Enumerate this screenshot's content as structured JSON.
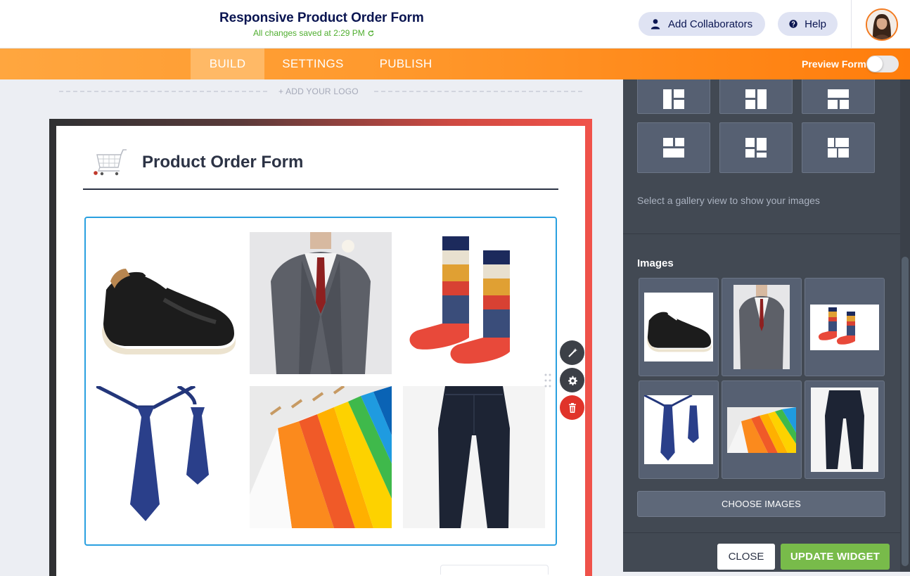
{
  "header": {
    "form_title": "Responsive Product Order Form",
    "save_status": "All changes saved at 2:29 PM",
    "add_collaborators": "Add Collaborators",
    "help": "Help"
  },
  "nav": {
    "tabs": [
      {
        "label": "BUILD",
        "active": true
      },
      {
        "label": "SETTINGS",
        "active": false
      },
      {
        "label": "PUBLISH",
        "active": false
      }
    ],
    "preview_label": "Preview Form",
    "preview_enabled": false
  },
  "canvas": {
    "logo_placeholder": "+ ADD YOUR LOGO",
    "form_heading": "Product Order Form",
    "gallery_images": [
      "sneaker",
      "gray-suit",
      "patterned-socks",
      "blue-ties",
      "colorful-shirts",
      "dark-jeans"
    ]
  },
  "panel": {
    "gallery_hint": "Select a gallery view to show your images",
    "images_label": "Images",
    "choose_images": "CHOOSE IMAGES",
    "close": "CLOSE",
    "update_widget": "UPDATE WIDGET"
  },
  "colors": {
    "brand_orange": "#ff7d0c",
    "accent_blue": "#2aa0e0",
    "success_green": "#78bb4a",
    "danger_red": "#e0332a",
    "navy_text": "#0a1551",
    "panel_bg": "#424953"
  }
}
